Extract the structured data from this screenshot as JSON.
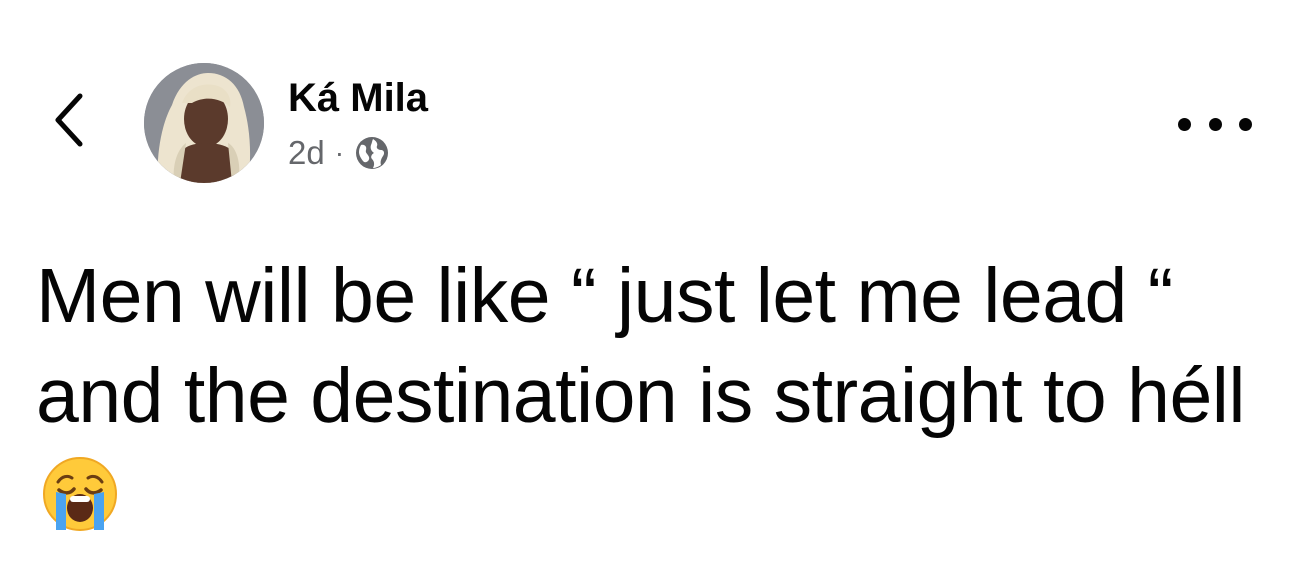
{
  "post": {
    "author_name": "Ká Mila",
    "timestamp": "2d",
    "separator": "·",
    "privacy_icon": "globe-icon",
    "text": "Men will be like “ just let me lead “ and the destination is straight to héll",
    "emoji": "crying-face-emoji"
  },
  "header": {
    "back_icon": "chevron-left-icon",
    "more_icon": "more-horizontal-icon"
  }
}
